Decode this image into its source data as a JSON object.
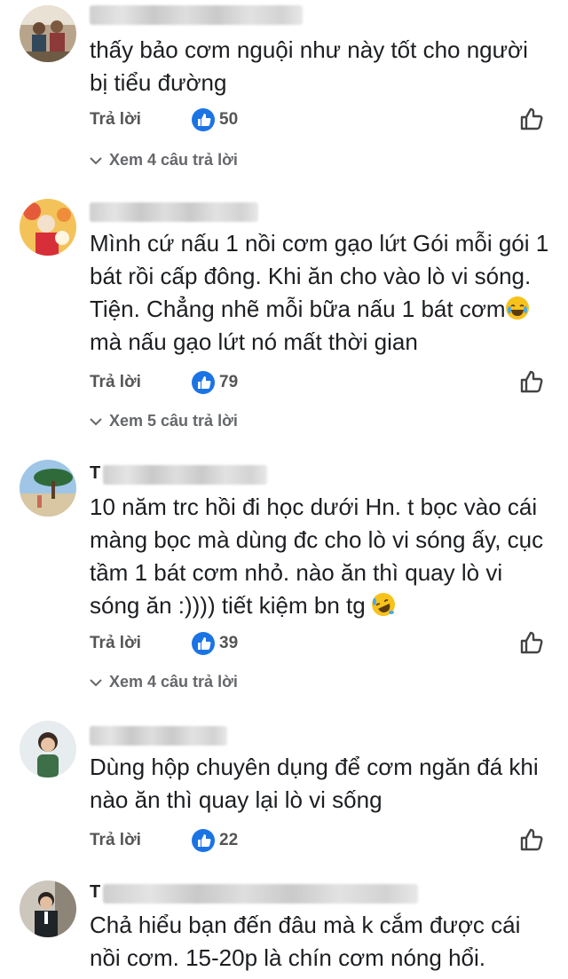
{
  "labels": {
    "reply": "Trả lời"
  },
  "comments": [
    {
      "name": "",
      "text": "thấy bảo cơm nguội như này tốt cho người bị tiểu đường",
      "likes": "50",
      "view_replies": "Xem 4 câu trả lời"
    },
    {
      "name": "",
      "text_a": "Mình cứ nấu 1 nồi cơm gạo lứt Gói mỗi gói 1 bát rồi cấp đông. Khi ăn cho vào lò vi sóng. Tiện. Chẳng nhẽ mỗi bữa nấu 1 bát cơm",
      "text_b": " mà nấu gạo lứt nó mất thời gian",
      "likes": "79",
      "view_replies": "Xem 5 câu trả lời"
    },
    {
      "name": "T",
      "text_a": "10 năm trc hồi đi học dưới Hn. t bọc vào cái màng bọc mà dùng đc cho lò vi sóng ấy, cục tầm 1 bát cơm nhỏ. nào ăn thì quay lò vi sóng ăn :)))) tiết kiệm bn tg ",
      "likes": "39",
      "view_replies": "Xem 4 câu trả lời"
    },
    {
      "name": "",
      "text": "Dùng hộp chuyên dụng để cơm ngăn đá khi nào ăn thì quay lại lò vi sống",
      "likes": "22"
    },
    {
      "name": "T",
      "text": "Chả hiểu bạn đến đâu mà k cắm được cái nồi cơm. 15-20p là chín cơm nóng hổi."
    }
  ],
  "icons": {
    "like_badge": "thumbs-up-filled-icon",
    "like_button": "thumbs-up-outline-icon",
    "chevron": "chevron-down-icon",
    "emoji_joy": "face-with-tears-of-joy-icon",
    "emoji_rofl": "rolling-on-floor-laughing-icon"
  },
  "colors": {
    "like_blue": "#1b74e4",
    "text": "#1c1e21",
    "muted": "#65676b"
  }
}
